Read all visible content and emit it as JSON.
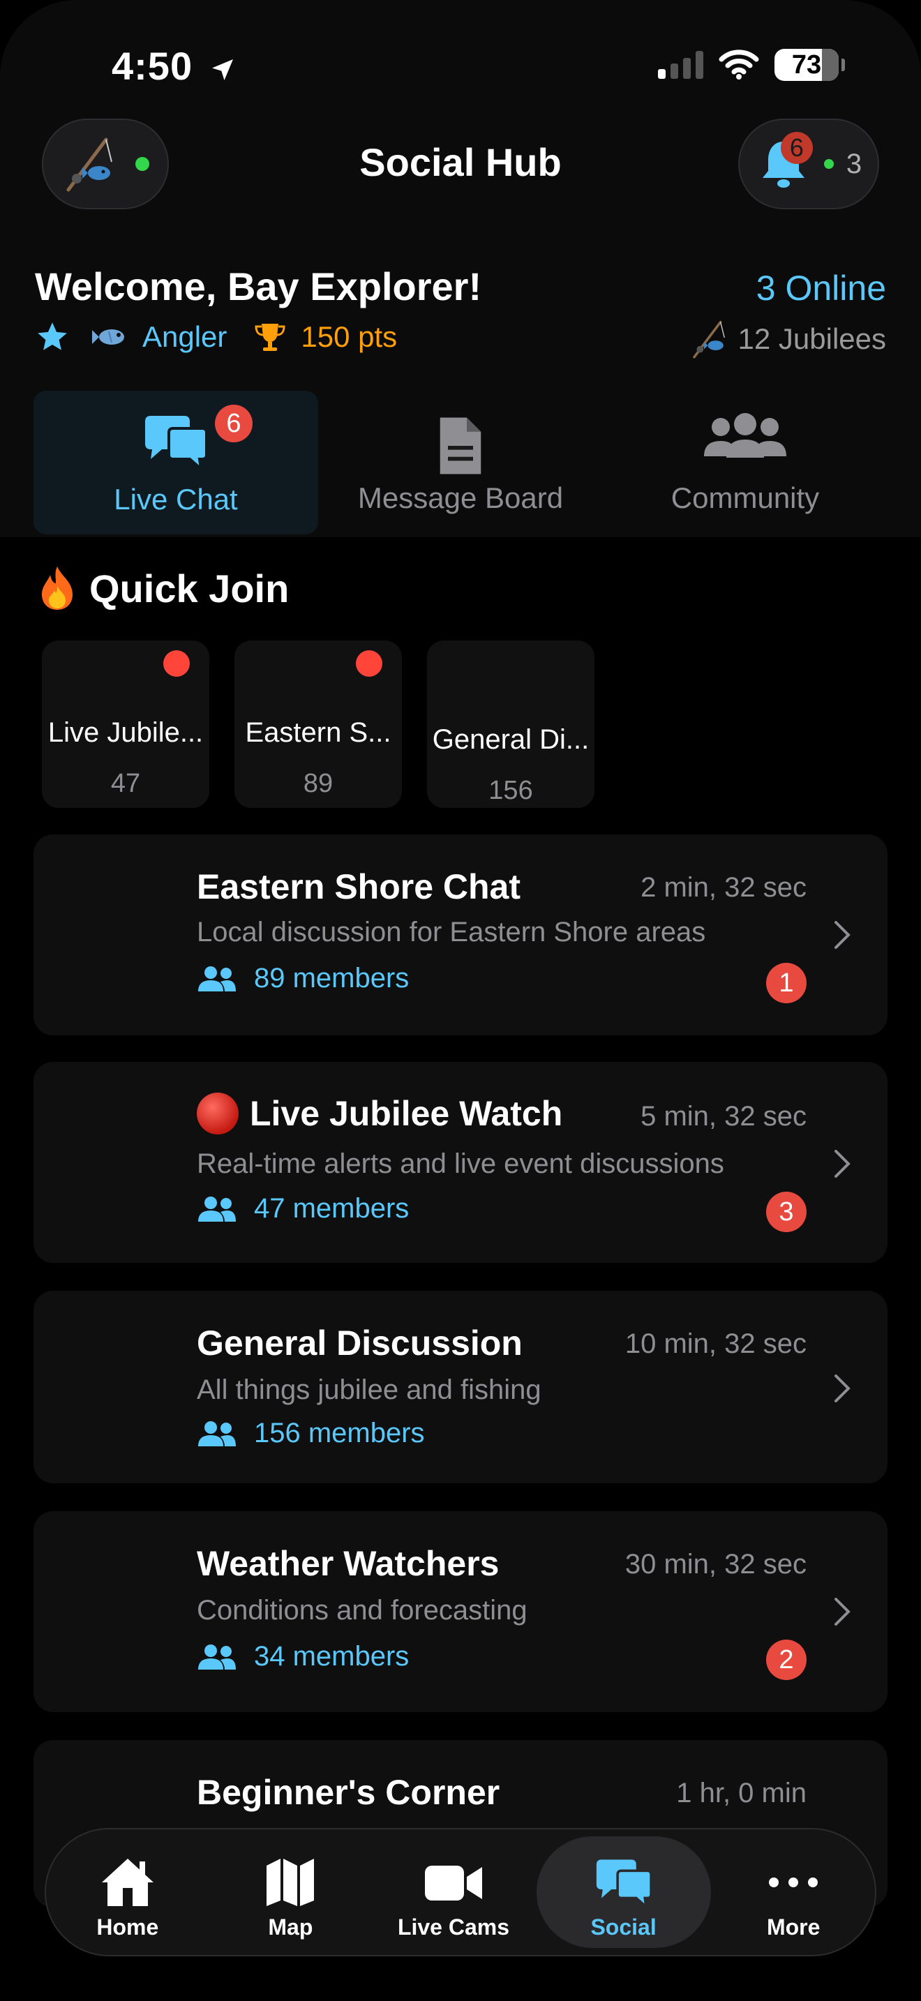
{
  "status_bar": {
    "time": "4:50",
    "battery": "73"
  },
  "header": {
    "title": "Social Hub",
    "notification_count": "6",
    "online_count": "3"
  },
  "welcome": {
    "greeting": "Welcome, Bay Explorer!",
    "rank": "Angler",
    "points": "150 pts",
    "online": "3 Online",
    "jubilees": "12 Jubilees"
  },
  "tabs": [
    {
      "label": "Live Chat",
      "badge": "6",
      "active": true
    },
    {
      "label": "Message Board"
    },
    {
      "label": "Community"
    }
  ],
  "quick_join": {
    "title": "Quick Join",
    "cards": [
      {
        "name": "Live Jubile...",
        "count": "47",
        "live": true
      },
      {
        "name": "Eastern S...",
        "count": "89",
        "live": true
      },
      {
        "name": "General Di...",
        "count": "156",
        "live": false
      }
    ]
  },
  "rooms": [
    {
      "name": "Eastern Shore Chat",
      "time": "2 min, 32 sec",
      "desc": "Local discussion for Eastern Shore areas",
      "members": "89 members",
      "badge": "1"
    },
    {
      "name": "Live Jubilee Watch",
      "time": "5 min, 32 sec",
      "desc": "Real-time alerts and live event discussions",
      "members": "47 members",
      "badge": "3"
    },
    {
      "name": "General Discussion",
      "time": "10 min, 32 sec",
      "desc": "All things jubilee and fishing",
      "members": "156 members"
    },
    {
      "name": "Weather Watchers",
      "time": "30 min, 32 sec",
      "desc": "Conditions and forecasting",
      "members": "34 members",
      "badge": "2"
    },
    {
      "name": "Beginner's Corner",
      "time": "1 hr, 0 min"
    }
  ],
  "nav": [
    {
      "label": "Home"
    },
    {
      "label": "Map"
    },
    {
      "label": "Live Cams"
    },
    {
      "label": "Social",
      "active": true
    },
    {
      "label": "More"
    }
  ],
  "colors": {
    "accent": "#5ac8fa",
    "badge": "#e84a3f",
    "points": "#ff9f0a",
    "online_dot": "#32d74b"
  }
}
